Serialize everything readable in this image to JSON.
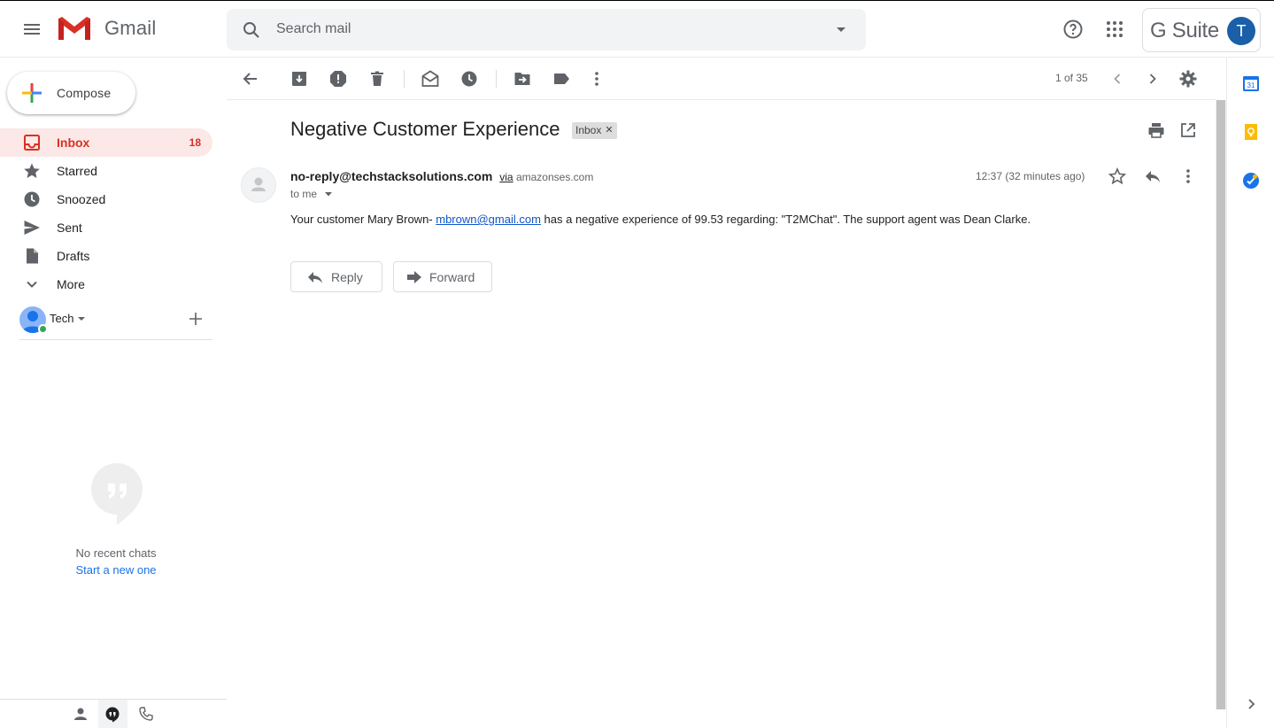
{
  "app": {
    "name": "Gmail"
  },
  "search": {
    "placeholder": "Search mail"
  },
  "header": {
    "gsuite_label": "G Suite",
    "avatar_letter": "T"
  },
  "compose": {
    "label": "Compose"
  },
  "nav": {
    "items": [
      {
        "label": "Inbox",
        "count": "18",
        "icon": "inbox-icon",
        "active": true
      },
      {
        "label": "Starred",
        "count": "",
        "icon": "star-icon"
      },
      {
        "label": "Snoozed",
        "count": "",
        "icon": "clock-icon"
      },
      {
        "label": "Sent",
        "count": "",
        "icon": "send-icon"
      },
      {
        "label": "Drafts",
        "count": "",
        "icon": "draft-icon"
      },
      {
        "label": "More",
        "count": "",
        "icon": "chevron-down-icon"
      }
    ]
  },
  "hangouts": {
    "user_name": "Tech",
    "no_chats": "No recent chats",
    "start_new": "Start a new one"
  },
  "toolbar": {
    "pager": "1 of 35"
  },
  "message": {
    "subject": "Negative Customer Experience",
    "label": "Inbox",
    "sender": "no-reply@techstacksolutions.com",
    "via_word": "via",
    "via_domain": "amazonses.com",
    "to": "to me",
    "time": "12:37 (32 minutes ago)",
    "body_prefix": "Your customer Mary Brown- ",
    "body_link": "mbrown@gmail.com",
    "body_suffix": " has a negative experience of 99.53 regarding: \"T2MChat\". The support agent was Dean Clarke."
  },
  "actions": {
    "reply": "Reply",
    "forward": "Forward"
  },
  "right_panel": {
    "calendar_day": "31"
  },
  "colors": {
    "accent_red": "#d93025",
    "active_bg": "#fce8e6",
    "link": "#1155cc",
    "avatar": "#1a5fa8"
  }
}
